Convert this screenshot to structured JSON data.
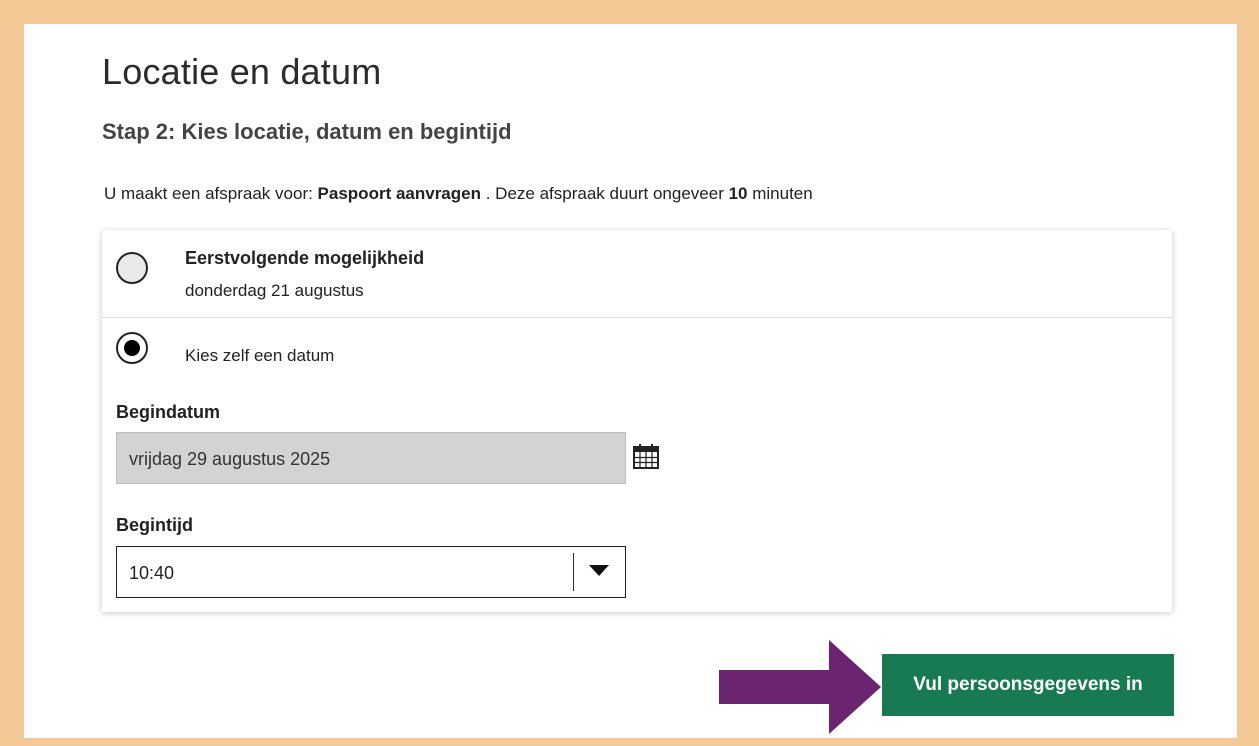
{
  "page": {
    "title": "Locatie en datum",
    "step_title": "Stap 2: Kies locatie, datum en begintijd"
  },
  "intro": {
    "prefix": "U maakt een afspraak voor: ",
    "service": "Paspoort aanvragen",
    "middle": " . Deze afspraak duurt ongeveer ",
    "duration": "10",
    "suffix": " minuten"
  },
  "options": {
    "first_available": {
      "title": "Eerstvolgende mogelijkheid",
      "date": "donderdag 21 augustus",
      "selected": false
    },
    "choose_date": {
      "label": "Kies zelf een datum",
      "selected": true
    }
  },
  "form": {
    "begin_date_label": "Begindatum",
    "begin_date_value": "vrijdag 29 augustus 2025",
    "begin_time_label": "Begintijd",
    "begin_time_value": "10:40"
  },
  "actions": {
    "next_label": "Vul persoonsgegevens in"
  },
  "colors": {
    "background_border": "#f5c996",
    "button": "#177a52",
    "arrow": "#6b2470",
    "date_field": "#d3d3d3"
  },
  "icons": {
    "calendar": "calendar-icon",
    "dropdown": "chevron-down-icon",
    "pointer": "arrow-right-icon"
  }
}
